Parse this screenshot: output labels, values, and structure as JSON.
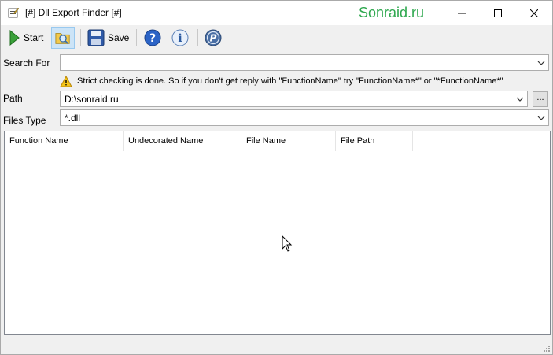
{
  "window": {
    "title": "[#] Dll Export Finder [#]",
    "watermark": "Sonraid.ru"
  },
  "toolbar": {
    "start_label": "Start",
    "save_label": "Save"
  },
  "form": {
    "search_for_label": "Search For",
    "search_for_value": "",
    "warning_text": "Strict checking is done. So if you don't get reply with \"FunctionName\" try \"FunctionName*\" or \"*FunctionName*\"",
    "path_label": "Path",
    "path_value": "D:\\sonraid.ru",
    "browse_label": "...",
    "files_type_label": "Files Type",
    "files_type_value": "*.dll"
  },
  "results": {
    "columns": [
      "Function Name",
      "Undecorated Name",
      "File Name",
      "File Path"
    ],
    "rows": []
  },
  "colors": {
    "watermark": "#2fa84f",
    "pressed_button_bg": "#cce4f7"
  }
}
